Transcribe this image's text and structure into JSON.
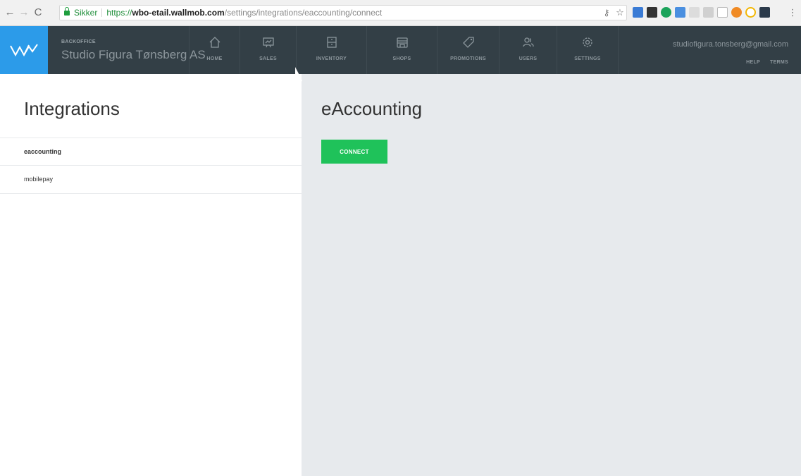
{
  "browser": {
    "secure_label": "Sikker",
    "url_scheme": "https://",
    "url_host": "wbo-etail.wallmob.com",
    "url_path": "/settings/integrations/eaccounting/connect"
  },
  "header": {
    "brand_sub": "BACKOFFICE",
    "brand_title": "Studio Figura Tønsberg AS",
    "nav": [
      {
        "label": "HOME",
        "icon": "home-icon"
      },
      {
        "label": "SALES",
        "icon": "sales-icon"
      },
      {
        "label": "INVENTORY",
        "icon": "inventory-icon"
      },
      {
        "label": "SHOPS",
        "icon": "shops-icon"
      },
      {
        "label": "PROMOTIONS",
        "icon": "tag-icon"
      },
      {
        "label": "USERS",
        "icon": "users-icon"
      },
      {
        "label": "SETTINGS",
        "icon": "gear-icon"
      }
    ],
    "user_email": "studiofigura.tonsberg@gmail.com",
    "help": "HELP",
    "terms": "TERMS"
  },
  "sidebar": {
    "title": "Integrations",
    "items": [
      {
        "label": "eaccounting",
        "active": true
      },
      {
        "label": "mobilepay",
        "active": false
      }
    ]
  },
  "main": {
    "title": "eAccounting",
    "connect_label": "CONNECT"
  },
  "colors": {
    "header_bg": "#333f46",
    "logo_bg": "#2c9be9",
    "connect_green": "#1fc25a",
    "panel_bg": "#e7eaed"
  }
}
